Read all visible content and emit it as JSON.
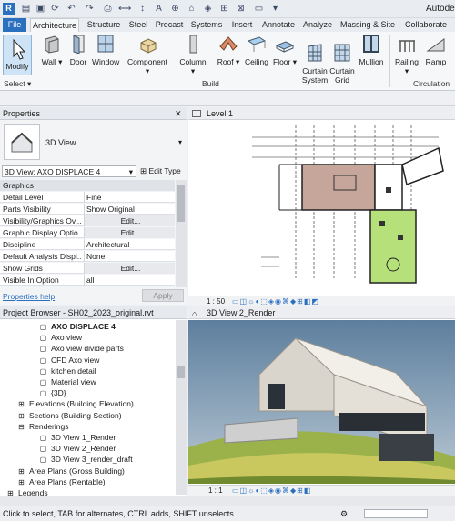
{
  "app": {
    "title_fragment": "Autodes"
  },
  "tabs": [
    "File",
    "Architecture",
    "Structure",
    "Steel",
    "Precast",
    "Systems",
    "Insert",
    "Annotate",
    "Analyze",
    "Massing & Site",
    "Collaborate"
  ],
  "ribbon": {
    "modify": "Modify",
    "select": "Select",
    "build_group": "Build",
    "circulation_group": "Circulation",
    "tools": [
      {
        "label": "Wall",
        "icon": "wall-icon"
      },
      {
        "label": "Door",
        "icon": "door-icon"
      },
      {
        "label": "Window",
        "icon": "window-icon"
      },
      {
        "label": "Component",
        "icon": "component-icon"
      },
      {
        "label": "Column",
        "icon": "column-icon"
      },
      {
        "label": "Roof",
        "icon": "roof-icon"
      },
      {
        "label": "Ceiling",
        "icon": "ceiling-icon"
      },
      {
        "label": "Floor",
        "icon": "floor-icon"
      },
      {
        "label": "Curtain\nSystem",
        "icon": "curtain-system-icon"
      },
      {
        "label": "Curtain\nGrid",
        "icon": "curtain-grid-icon"
      },
      {
        "label": "Mullion",
        "icon": "mullion-icon"
      },
      {
        "label": "Railing",
        "icon": "railing-icon"
      },
      {
        "label": "Ramp",
        "icon": "ramp-icon"
      }
    ]
  },
  "properties": {
    "title": "Properties",
    "type_name": "3D View",
    "instance": "3D View: AXO DISPLACE 4",
    "edit_type": "Edit Type",
    "section": "Graphics",
    "rows": [
      {
        "k": "Detail Level",
        "v": "Fine",
        "btn": false
      },
      {
        "k": "Parts Visibility",
        "v": "Show Original",
        "btn": false
      },
      {
        "k": "Visibility/Graphics Ov...",
        "v": "Edit...",
        "btn": true
      },
      {
        "k": "Graphic Display Optio...",
        "v": "Edit...",
        "btn": true
      },
      {
        "k": "Discipline",
        "v": "Architectural",
        "btn": false
      },
      {
        "k": "Default Analysis Displ...",
        "v": "None",
        "btn": false
      },
      {
        "k": "Show Grids",
        "v": "Edit...",
        "btn": true
      },
      {
        "k": "Visible In Option",
        "v": "all",
        "btn": false
      }
    ],
    "help": "Properties help",
    "apply": "Apply"
  },
  "browser": {
    "title": "Project Browser - SH02_2023_original.rvt",
    "items": [
      {
        "label": "AXO DISPLACE 4",
        "level": 3,
        "bold": true,
        "type": "view"
      },
      {
        "label": "Axo view",
        "level": 3,
        "type": "view"
      },
      {
        "label": "Axo view divide parts",
        "level": 3,
        "type": "view"
      },
      {
        "label": "CFD Axo view",
        "level": 3,
        "type": "view"
      },
      {
        "label": "kitchen detail",
        "level": 3,
        "type": "view"
      },
      {
        "label": "Material view",
        "level": 3,
        "type": "view"
      },
      {
        "label": "{3D}",
        "level": 3,
        "type": "view"
      },
      {
        "label": "Elevations (Building Elevation)",
        "level": 1,
        "type": "plus"
      },
      {
        "label": "Sections (Building Section)",
        "level": 1,
        "type": "plus"
      },
      {
        "label": "Renderings",
        "level": 1,
        "type": "minus"
      },
      {
        "label": "3D View 1_Render",
        "level": 2,
        "type": "view"
      },
      {
        "label": "3D View 2_Render",
        "level": 2,
        "type": "view"
      },
      {
        "label": "3D View 3_render_draft",
        "level": 2,
        "type": "view"
      },
      {
        "label": "Area Plans (Gross Building)",
        "level": 1,
        "type": "plus"
      },
      {
        "label": "Area Plans (Rentable)",
        "level": 1,
        "type": "plus"
      },
      {
        "label": "Legends",
        "level": 0,
        "type": "plus"
      }
    ]
  },
  "views": {
    "plan_title": "Level 1",
    "plan_scale": "1 : 50",
    "render_title": "3D View 2_Render",
    "render_scale": "1 : 1"
  },
  "status": {
    "text": "Click to select, TAB for alternates, CTRL adds, SHIFT unselects."
  },
  "colors": {
    "accent": "#2b6fbf",
    "sky": "#5d7f9e",
    "grass": "#9bb24a",
    "plan_room": "#c6a69a",
    "plan_green": "#b6e07a"
  }
}
